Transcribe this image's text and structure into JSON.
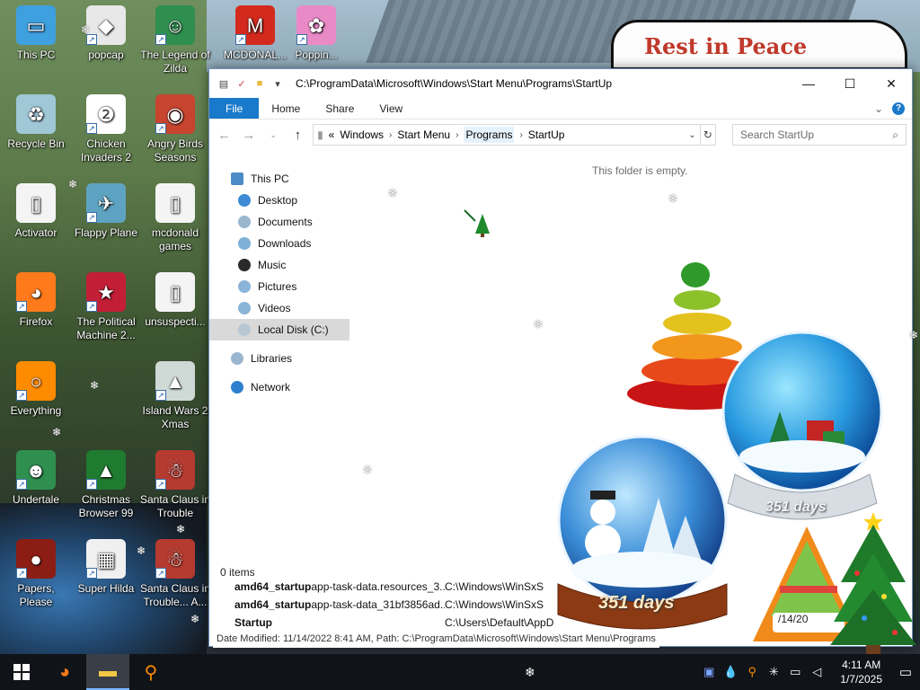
{
  "wallpaper": {
    "sign_text": "Rest in Peace"
  },
  "desktop_icons": [
    {
      "label": "This PC",
      "name": "this-pc",
      "color": "#3fa0e0",
      "glyph": "▭",
      "shortcut": false
    },
    {
      "label": "popcap",
      "name": "popcap",
      "color": "#e8e8e8",
      "glyph": "◆",
      "shortcut": true
    },
    {
      "label": "The Legend of Zilda",
      "name": "legend-of-zilda",
      "color": "#2f8f4f",
      "glyph": "☺",
      "shortcut": true
    },
    {
      "label": "MCDONAL...",
      "name": "mcdonalds",
      "color": "#d42a1e",
      "glyph": "M",
      "shortcut": true
    },
    {
      "label": "Poppin...",
      "name": "pig-game",
      "color": "#e98ac7",
      "glyph": "✿",
      "shortcut": true
    },
    {
      "label": "Recycle Bin",
      "name": "recycle-bin",
      "color": "#9fc7d6",
      "glyph": "♻",
      "shortcut": false
    },
    {
      "label": "Chicken Invaders 2",
      "name": "chicken-invaders-2",
      "color": "#ffffff",
      "glyph": "❷",
      "shortcut": true
    },
    {
      "label": "Angry Birds Seasons",
      "name": "angry-birds-seasons",
      "color": "#c7442f",
      "glyph": "◉",
      "shortcut": true
    },
    {
      "label": "Activator",
      "name": "activator",
      "color": "#f4f4f4",
      "glyph": "▯",
      "shortcut": false
    },
    {
      "label": "Flappy Plane",
      "name": "flappy-plane",
      "color": "#5ea4c2",
      "glyph": "✈",
      "shortcut": true
    },
    {
      "label": "mcdonald games",
      "name": "mcdonald-games",
      "color": "#f4f4f4",
      "glyph": "▯",
      "shortcut": false
    },
    {
      "label": "Firefox",
      "name": "firefox",
      "color": "#ff7a1a",
      "glyph": "◕",
      "shortcut": true
    },
    {
      "label": "The Political Machine 2...",
      "name": "political-machine",
      "color": "#c21f36",
      "glyph": "★",
      "shortcut": true
    },
    {
      "label": "unsuspecti...",
      "name": "unsuspecting-file",
      "color": "#f4f4f4",
      "glyph": "▯",
      "shortcut": false
    },
    {
      "label": "Everything",
      "name": "everything",
      "color": "#ff8c00",
      "glyph": "○",
      "shortcut": true
    },
    {
      "label": "Island Wars 2 Xmas",
      "name": "island-wars-2-xmas",
      "color": "#cfd9d6",
      "glyph": "▲",
      "shortcut": true
    },
    {
      "label": "Undertale",
      "name": "undertale",
      "color": "#2f8f4f",
      "glyph": "☻",
      "shortcut": true
    },
    {
      "label": "Christmas Browser 99",
      "name": "christmas-browser-99",
      "color": "#1f7b2f",
      "glyph": "▲",
      "shortcut": true
    },
    {
      "label": "Santa Claus in Trouble",
      "name": "santa-claus-in-trouble",
      "color": "#b53a2f",
      "glyph": "☃",
      "shortcut": true
    },
    {
      "label": "Papers, Please",
      "name": "papers-please",
      "color": "#8c1d14",
      "glyph": "●",
      "shortcut": true
    },
    {
      "label": "Super Hilda",
      "name": "super-hilda",
      "color": "#f0f0f0",
      "glyph": "▦",
      "shortcut": true
    },
    {
      "label": "Santa Claus in Trouble... A...",
      "name": "santa-claus-in-trouble-2",
      "color": "#b53a2f",
      "glyph": "☃",
      "shortcut": true
    }
  ],
  "window": {
    "title_path": "C:\\ProgramData\\Microsoft\\Windows\\Start Menu\\Programs\\StartUp",
    "tabs": [
      "File",
      "Home",
      "Share",
      "View"
    ],
    "help": "?",
    "address": {
      "prefix": "«",
      "segments": [
        "Windows",
        "Start Menu",
        "Programs",
        "StartUp"
      ]
    },
    "search_placeholder": "Search StartUp",
    "nav": {
      "this_pc": "This PC",
      "items": [
        "Desktop",
        "Documents",
        "Downloads",
        "Music",
        "Pictures",
        "Videos",
        "Local Disk (C:)"
      ],
      "libraries": "Libraries",
      "network": "Network"
    },
    "empty_message": "This folder is empty.",
    "status": "0 items",
    "behind_rows": [
      {
        "name_bold": "amd64_startup",
        "name_rest": "app-task-data.resources_3...",
        "path": "C:\\Windows\\WinSxS"
      },
      {
        "name_bold": "amd64_startup",
        "name_rest": "app-task-data_31bf3856ad...",
        "path": "C:\\Windows\\WinSxS"
      },
      {
        "name_bold": "Startup",
        "name_rest": "",
        "path": "C:\\Users\\Default\\AppD"
      }
    ],
    "tooltip": "Date Modified: 11/14/2022 8:41 AM, Path: C:\\ProgramData\\Microsoft\\Windows\\Start Menu\\Programs"
  },
  "gadgets": {
    "globe_big_days": "351 days",
    "globe_small_days": "351 days",
    "calendar_date": "/14/20"
  },
  "taskbar": {
    "apps": [
      {
        "name": "firefox",
        "glyph": "◕",
        "color": "#ff7a1a",
        "active": false
      },
      {
        "name": "file-explorer",
        "glyph": "▬",
        "color": "#f2c744",
        "active": true
      },
      {
        "name": "everything",
        "glyph": "⚲",
        "color": "#ff8c00",
        "active": false
      }
    ],
    "time": "4:11 AM",
    "date": "1/7/2025"
  },
  "colors": {
    "accent": "#1979ca",
    "taskbar": "#101318"
  }
}
